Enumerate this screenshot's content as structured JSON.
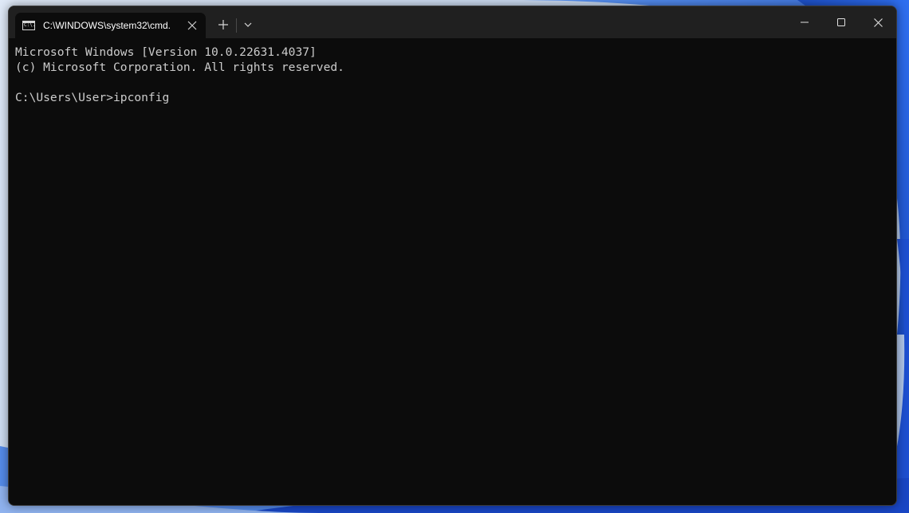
{
  "window": {
    "tab_title": "C:\\WINDOWS\\system32\\cmd.",
    "tab_icon": "cmd-icon",
    "tab_icon_text": "C:\\.",
    "new_tab_label": "+"
  },
  "terminal": {
    "lines": [
      "Microsoft Windows [Version 10.0.22631.4037]",
      "(c) Microsoft Corporation. All rights reserved.",
      "",
      "C:\\Users\\User>ipconfig"
    ]
  },
  "colors": {
    "terminal_bg": "#0c0c0c",
    "titlebar_bg": "#202020",
    "terminal_text": "#cccccc"
  }
}
